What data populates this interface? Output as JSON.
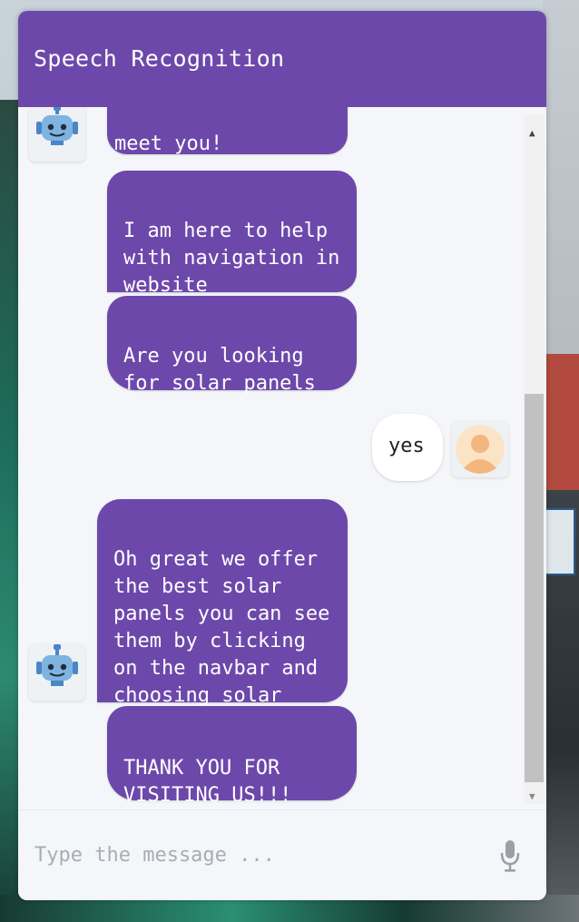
{
  "header": {
    "title": "Speech Recognition"
  },
  "messages": [
    {
      "sender": "bot",
      "text": "meet you!"
    },
    {
      "sender": "bot",
      "text": "I am here to help\nwith navigation in\nwebsite"
    },
    {
      "sender": "bot",
      "text": "Are you looking\nfor solar panels"
    },
    {
      "sender": "user",
      "text": "yes"
    },
    {
      "sender": "bot",
      "text": "Oh great we offer\nthe best solar\npanels you can see\nthem by clicking\non the navbar and\nchoosing solar"
    },
    {
      "sender": "bot",
      "text": "THANK YOU FOR\nVISITING US!!!"
    }
  ],
  "input": {
    "placeholder": "Type the message ...",
    "value": ""
  },
  "icons": {
    "bot": "robot-icon",
    "user": "user-avatar-icon",
    "mic": "microphone-icon"
  },
  "colors": {
    "accent": "#6d48ab",
    "panel": "#f4f6f9",
    "user_bubble": "#ffffff"
  }
}
